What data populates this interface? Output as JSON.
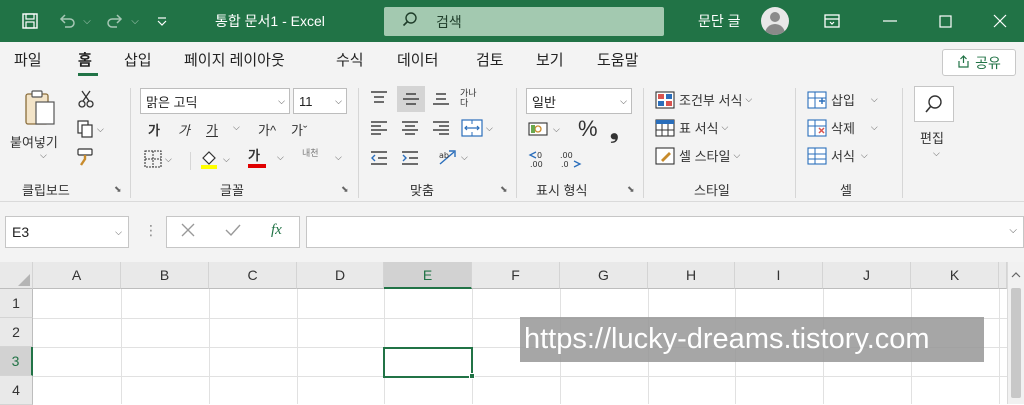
{
  "titlebar": {
    "doc_title": "통합 문서1  -  Excel",
    "search_placeholder": "검색",
    "user_name": "문단 글",
    "icons": {
      "save": "💾",
      "undo": "↶",
      "redo": "↷",
      "customize": "⌵",
      "ribbon_display": "⊡",
      "minimize": "—",
      "maximize": "☐",
      "close": "✕"
    }
  },
  "menu": {
    "tabs": [
      "파일",
      "홈",
      "삽입",
      "페이지 레이아웃",
      "수식",
      "데이터",
      "검토",
      "보기",
      "도움말"
    ],
    "active": "홈",
    "share": "공유"
  },
  "ribbon": {
    "clipboard": {
      "label": "클립보드",
      "paste": "붙여넣기"
    },
    "font": {
      "label": "글꼴",
      "font_name": "맑은 고딕",
      "font_size": "11",
      "bold": "가",
      "italic": "가",
      "underline": "가",
      "grow": "가^",
      "shrink": "가ˇ",
      "font_color": "가",
      "phonetic": "내천"
    },
    "alignment": {
      "label": "맞춤",
      "wrap": "가나다"
    },
    "number": {
      "label": "표시 형식",
      "format": "일반",
      "percent": "%",
      "comma": "❟"
    },
    "styles": {
      "label": "스타일",
      "conditional": "조건부 서식",
      "table": "표 서식",
      "cell_style": "셀 스타일"
    },
    "cells": {
      "label": "셀",
      "insert": "삽입",
      "delete": "삭제",
      "format": "서식"
    },
    "editing": {
      "label": "편집"
    }
  },
  "formula_bar": {
    "name_box": "E3",
    "fx": "fx",
    "formula": ""
  },
  "grid": {
    "columns": [
      "A",
      "B",
      "C",
      "D",
      "E",
      "F",
      "G",
      "H",
      "I",
      "J",
      "K"
    ],
    "rows": [
      "1",
      "2",
      "3",
      "4"
    ],
    "selected_column": "E",
    "selected_row": "3"
  },
  "watermark": "https://lucky-dreams.tistory.com",
  "colors": {
    "accent": "#217346",
    "ribbon_bg": "#f3f3f3"
  }
}
